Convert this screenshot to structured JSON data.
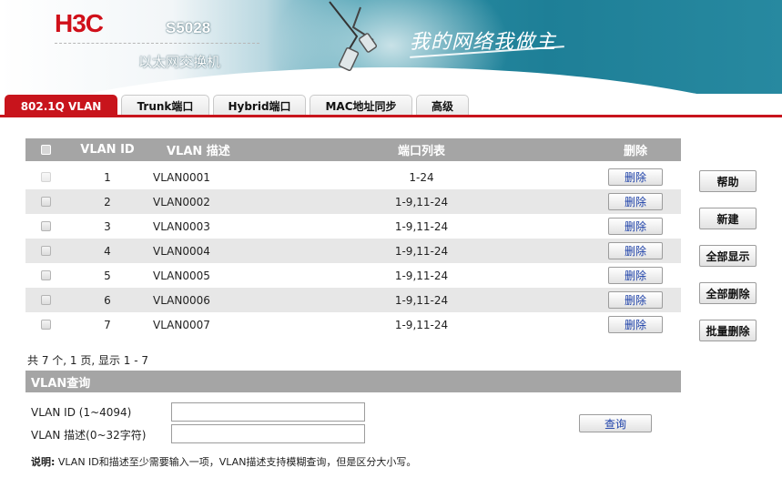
{
  "header": {
    "logo_text": "H3C",
    "model": "S5028",
    "subtitle": "以太网交换机",
    "slogan": "我的网络我做主"
  },
  "tabs": [
    {
      "label": "802.1Q VLAN",
      "active": true
    },
    {
      "label": "Trunk端口",
      "active": false
    },
    {
      "label": "Hybrid端口",
      "active": false
    },
    {
      "label": "MAC地址同步",
      "active": false
    },
    {
      "label": "高级",
      "active": false
    }
  ],
  "table": {
    "columns": {
      "id": "VLAN ID",
      "desc": "VLAN 描述",
      "ports": "端口列表",
      "delete": "删除"
    },
    "rows": [
      {
        "id": "1",
        "desc": "VLAN0001",
        "ports": "1-24",
        "delete_label": "删除",
        "checkbox_disabled": true
      },
      {
        "id": "2",
        "desc": "VLAN0002",
        "ports": "1-9,11-24",
        "delete_label": "删除"
      },
      {
        "id": "3",
        "desc": "VLAN0003",
        "ports": "1-9,11-24",
        "delete_label": "删除"
      },
      {
        "id": "4",
        "desc": "VLAN0004",
        "ports": "1-9,11-24",
        "delete_label": "删除"
      },
      {
        "id": "5",
        "desc": "VLAN0005",
        "ports": "1-9,11-24",
        "delete_label": "删除"
      },
      {
        "id": "6",
        "desc": "VLAN0006",
        "ports": "1-9,11-24",
        "delete_label": "删除"
      },
      {
        "id": "7",
        "desc": "VLAN0007",
        "ports": "1-9,11-24",
        "delete_label": "删除"
      }
    ]
  },
  "side_buttons": {
    "help": "帮助",
    "new": "新建",
    "show_all": "全部显示",
    "delete_all": "全部删除",
    "batch_delete": "批量删除"
  },
  "pager": {
    "text": "共 7 个, 1 页, 显示 1 - 7"
  },
  "query": {
    "title": "VLAN查询",
    "id_label": "VLAN ID (1~4094)",
    "id_value": "",
    "desc_label": "VLAN 描述(0~32字符)",
    "desc_value": "",
    "button": "查询",
    "note_prefix": "说明:",
    "note_text": " VLAN ID和描述至少需要输入一项，VLAN描述支持模糊查询，但是区分大小写。"
  },
  "colors": {
    "accent": "#c8141c",
    "header_bar": "#a5a5a5",
    "row_alt": "#e7e7e7",
    "link_text": "#1b3fa8"
  },
  "icons": {
    "banner_art": "network-cable-icon",
    "checkbox": "checkbox-icon"
  }
}
